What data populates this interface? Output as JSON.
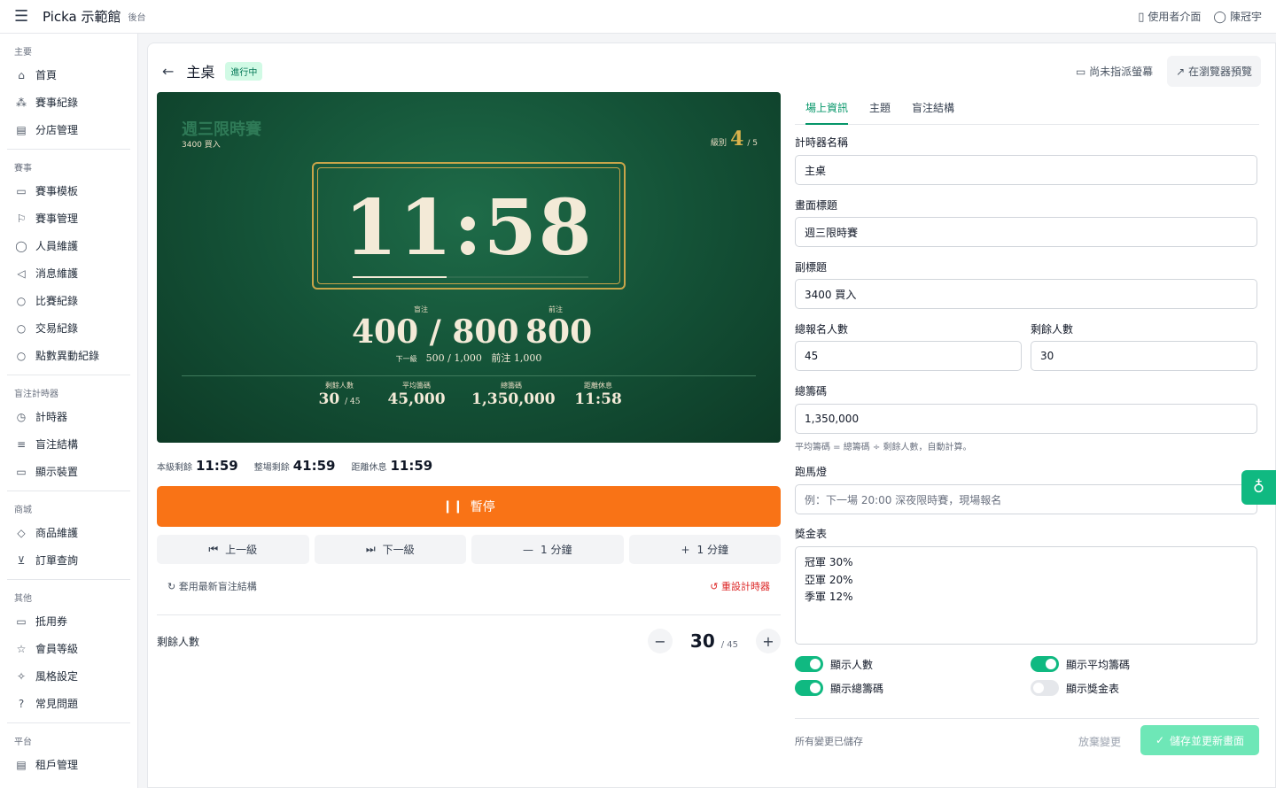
{
  "topbar": {
    "brand": "Picka 示範館",
    "brand_sub": "後台",
    "user_view": "使用者介面",
    "user_name": "陳冠宇"
  },
  "sidebar": {
    "sections": [
      {
        "title": "主要",
        "items": [
          {
            "label": "首頁",
            "icon": "home-icon"
          },
          {
            "label": "賽事紀錄",
            "icon": "sitemap-icon"
          },
          {
            "label": "分店管理",
            "icon": "building-icon"
          }
        ]
      },
      {
        "title": "賽事",
        "items": [
          {
            "label": "賽事模板",
            "icon": "calendar-icon"
          },
          {
            "label": "賽事管理",
            "icon": "flag-icon"
          },
          {
            "label": "人員維護",
            "icon": "user-icon"
          },
          {
            "label": "消息維護",
            "icon": "megaphone-icon"
          },
          {
            "label": "比賽紀錄",
            "icon": "search-icon"
          },
          {
            "label": "交易紀錄",
            "icon": "search-icon"
          },
          {
            "label": "點數異動紀錄",
            "icon": "search-icon"
          }
        ]
      },
      {
        "title": "盲注計時器",
        "items": [
          {
            "label": "計時器",
            "icon": "timer-icon"
          },
          {
            "label": "盲注結構",
            "icon": "list-icon"
          },
          {
            "label": "顯示裝置",
            "icon": "monitor-icon"
          }
        ]
      },
      {
        "title": "商城",
        "items": [
          {
            "label": "商品維護",
            "icon": "box-icon"
          },
          {
            "label": "訂單查詢",
            "icon": "cart-icon"
          }
        ]
      },
      {
        "title": "其他",
        "items": [
          {
            "label": "抵用券",
            "icon": "ticket-icon"
          },
          {
            "label": "會員等級",
            "icon": "star-icon"
          },
          {
            "label": "風格設定",
            "icon": "sparkle-icon"
          },
          {
            "label": "常見問題",
            "icon": "question-icon"
          }
        ]
      },
      {
        "title": "平台",
        "items": [
          {
            "label": "租戶管理",
            "icon": "building-icon"
          }
        ]
      }
    ]
  },
  "header": {
    "title": "主桌",
    "status": "進行中",
    "unassigned": "尚未指派螢幕",
    "preview": "在瀏覽器預覽"
  },
  "screen": {
    "title": "週三限時賽",
    "subtitle": "3400 買入",
    "level_label": "級別",
    "level": "4",
    "level_total": "/ 5",
    "clock": "11:58",
    "progress": 0.4,
    "blinds_label": "盲注",
    "blinds": "400 / 800",
    "ante_label": "前注",
    "ante": "800",
    "next_label": "下一級",
    "next_blinds": "500 / 1,000",
    "next_ante": "前注 1,000",
    "stats": [
      {
        "label": "剩餘人數",
        "value": "30",
        "suffix": "/ 45"
      },
      {
        "label": "平均籌碼",
        "value": "45,000",
        "suffix": ""
      },
      {
        "label": "總籌碼",
        "value": "1,350,000",
        "suffix": ""
      },
      {
        "label": "距離休息",
        "value": "11:58",
        "suffix": ""
      }
    ]
  },
  "timers": {
    "level_label": "本級剩餘",
    "level_val": "11:59",
    "total_label": "整場剩餘",
    "total_val": "41:59",
    "break_label": "距離休息",
    "break_val": "11:59"
  },
  "controls": {
    "pause": "暫停",
    "prev": "上一級",
    "next": "下一級",
    "minus": "1 分鐘",
    "plus": "1 分鐘",
    "apply": "套用最新盲注結構",
    "reset": "重設計時器"
  },
  "remain": {
    "label": "剩餘人數",
    "value": "30",
    "total": "/ 45"
  },
  "panel": {
    "tabs": [
      "場上資訊",
      "主題",
      "盲注結構"
    ],
    "timer_name_label": "計時器名稱",
    "timer_name": "主桌",
    "screen_title_label": "畫面標題",
    "screen_title": "週三限時賽",
    "subtitle_label": "副標題",
    "subtitle": "3400 買入",
    "entries_label": "總報名人數",
    "entries": "45",
    "remaining_label": "剩餘人數",
    "remaining": "30",
    "chips_label": "總籌碼",
    "chips": "1,350,000",
    "chips_hint": "平均籌碼 = 總籌碼 ÷ 剩餘人數，自動計算。",
    "ticker_label": "跑馬燈",
    "ticker_placeholder": "例：下一場 20:00 深夜限時賽，現場報名",
    "prize_label": "獎金表",
    "prize_lines": [
      "冠軍 30%",
      "亞軍 20%",
      "季軍 12%"
    ],
    "toggles": [
      {
        "label": "顯示人數",
        "on": true
      },
      {
        "label": "顯示平均籌碼",
        "on": true
      },
      {
        "label": "顯示總籌碼",
        "on": true
      },
      {
        "label": "顯示獎金表",
        "on": false
      }
    ],
    "saved_text": "所有變更已儲存",
    "discard": "放棄變更",
    "save": "儲存並更新畫面"
  }
}
